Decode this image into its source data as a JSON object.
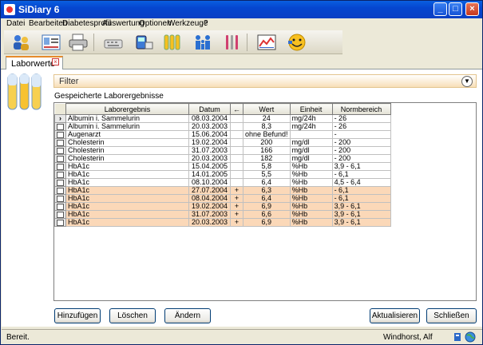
{
  "window": {
    "title": "SiDiary 6"
  },
  "menu": [
    "Datei",
    "Bearbeiten",
    "Diabetesprofil",
    "Auswertung",
    "Optionen",
    "Werkzeuge",
    "?"
  ],
  "toolbar_icons": [
    "people-icon",
    "id-card-icon",
    "printer-icon",
    "keyboard-icon",
    "device-icon",
    "test-tubes-icon",
    "family-icon",
    "cutlery-icon",
    "chart-icon",
    "smiley-icon"
  ],
  "tab": {
    "label": "Laborwerte"
  },
  "filter": {
    "label": "Filter"
  },
  "section_label": "Gespeicherte Laborergebnisse",
  "table": {
    "columns": [
      "Laborergebnis",
      "Datum",
      "←",
      "Wert",
      "Einheit",
      "Normbereich"
    ],
    "rows": [
      {
        "name": "Albumin i. Sammelurin",
        "date": "08.03.2004",
        "flag": "",
        "value": "24",
        "unit": "mg/24h",
        "range": "- 26",
        "hl": false
      },
      {
        "name": "Albumin i. Sammelurin",
        "date": "20.03.2003",
        "flag": "",
        "value": "8,3",
        "unit": "mg/24h",
        "range": "- 26",
        "hl": false
      },
      {
        "name": "Augenarzt",
        "date": "15.06.2004",
        "flag": "",
        "value": "ohne Befund!",
        "unit": "",
        "range": "-",
        "hl": false
      },
      {
        "name": "Cholesterin",
        "date": "19.02.2004",
        "flag": "",
        "value": "200",
        "unit": "mg/dl",
        "range": "- 200",
        "hl": false
      },
      {
        "name": "Cholesterin",
        "date": "31.07.2003",
        "flag": "",
        "value": "166",
        "unit": "mg/dl",
        "range": "- 200",
        "hl": false
      },
      {
        "name": "Cholesterin",
        "date": "20.03.2003",
        "flag": "",
        "value": "182",
        "unit": "mg/dl",
        "range": "- 200",
        "hl": false
      },
      {
        "name": "HbA1c",
        "date": "15.04.2005",
        "flag": "",
        "value": "5,8",
        "unit": "%Hb",
        "range": "3,9 - 6,1",
        "hl": false
      },
      {
        "name": "HbA1c",
        "date": "14.01.2005",
        "flag": "",
        "value": "5,5",
        "unit": "%Hb",
        "range": "- 6,1",
        "hl": false
      },
      {
        "name": "HbA1c",
        "date": "08.10.2004",
        "flag": "",
        "value": "6,4",
        "unit": "%Hb",
        "range": "4,5 - 6,4",
        "hl": false
      },
      {
        "name": "HbA1c",
        "date": "27.07.2004",
        "flag": "+",
        "value": "6,3",
        "unit": "%Hb",
        "range": "- 6,1",
        "hl": true
      },
      {
        "name": "HbA1c",
        "date": "08.04.2004",
        "flag": "+",
        "value": "6,4",
        "unit": "%Hb",
        "range": "- 6,1",
        "hl": true
      },
      {
        "name": "HbA1c",
        "date": "19.02.2004",
        "flag": "+",
        "value": "6,9",
        "unit": "%Hb",
        "range": "3,9 - 6,1",
        "hl": true
      },
      {
        "name": "HbA1c",
        "date": "31.07.2003",
        "flag": "+",
        "value": "6,6",
        "unit": "%Hb",
        "range": "3,9 - 6,1",
        "hl": true
      },
      {
        "name": "HbA1c",
        "date": "20.03.2003",
        "flag": "+",
        "value": "6,9",
        "unit": "%Hb",
        "range": "3,9 - 6,1",
        "hl": true
      }
    ]
  },
  "buttons": {
    "add": "Hinzufügen",
    "delete": "Löschen",
    "edit": "Ändern",
    "refresh": "Aktualisieren",
    "close": "Schließen"
  },
  "status": {
    "left": "Bereit.",
    "user": "Windhorst, Alf"
  }
}
